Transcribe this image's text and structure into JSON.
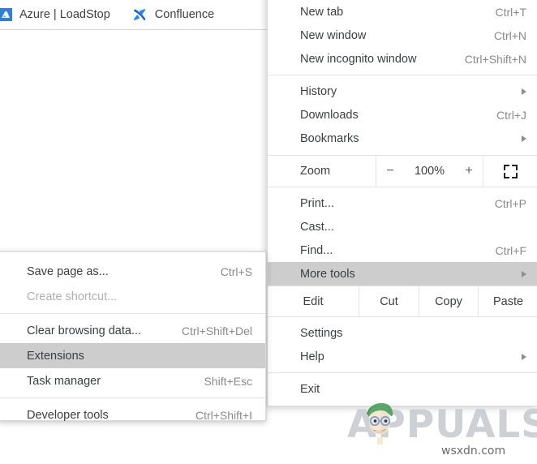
{
  "bookmarks_bar": {
    "items": [
      {
        "label": "Azure | LoadStop",
        "icon": "azure-favicon"
      },
      {
        "label": "Confluence",
        "icon": "confluence-logo-icon"
      }
    ]
  },
  "main_menu": {
    "groups": [
      {
        "items": [
          {
            "label": "New tab",
            "accel": "Ctrl+T",
            "submenu": false,
            "state": "normal"
          },
          {
            "label": "New window",
            "accel": "Ctrl+N",
            "submenu": false,
            "state": "normal"
          },
          {
            "label": "New incognito window",
            "accel": "Ctrl+Shift+N",
            "submenu": false,
            "state": "normal"
          }
        ]
      },
      {
        "items": [
          {
            "label": "History",
            "accel": "",
            "submenu": true,
            "state": "normal"
          },
          {
            "label": "Downloads",
            "accel": "Ctrl+J",
            "submenu": false,
            "state": "normal"
          },
          {
            "label": "Bookmarks",
            "accel": "",
            "submenu": true,
            "state": "normal"
          }
        ]
      },
      {
        "zoom_row": {
          "label": "Zoom",
          "minus": "−",
          "value": "100%",
          "plus": "+",
          "fullscreen_icon": "fullscreen-icon"
        }
      },
      {
        "items": [
          {
            "label": "Print...",
            "accel": "Ctrl+P",
            "submenu": false,
            "state": "normal"
          },
          {
            "label": "Cast...",
            "accel": "",
            "submenu": false,
            "state": "normal"
          },
          {
            "label": "Find...",
            "accel": "Ctrl+F",
            "submenu": false,
            "state": "normal"
          },
          {
            "label": "More tools",
            "accel": "",
            "submenu": true,
            "state": "highlight"
          }
        ]
      },
      {
        "edit_row": {
          "label": "Edit",
          "cut": "Cut",
          "copy": "Copy",
          "paste": "Paste"
        }
      },
      {
        "items": [
          {
            "label": "Settings",
            "accel": "",
            "submenu": false,
            "state": "normal"
          },
          {
            "label": "Help",
            "accel": "",
            "submenu": true,
            "state": "normal"
          }
        ]
      },
      {
        "items": [
          {
            "label": "Exit",
            "accel": "",
            "submenu": false,
            "state": "normal"
          }
        ]
      }
    ]
  },
  "more_tools_submenu": {
    "groups": [
      {
        "items": [
          {
            "label": "Save page as...",
            "accel": "Ctrl+S",
            "state": "normal"
          },
          {
            "label": "Create shortcut...",
            "accel": "",
            "state": "disabled"
          }
        ]
      },
      {
        "items": [
          {
            "label": "Clear browsing data...",
            "accel": "Ctrl+Shift+Del",
            "state": "normal"
          },
          {
            "label": "Extensions",
            "accel": "",
            "state": "highlight"
          },
          {
            "label": "Task manager",
            "accel": "Shift+Esc",
            "state": "normal"
          }
        ]
      },
      {
        "items": [
          {
            "label": "Developer tools",
            "accel": "Ctrl+Shift+I",
            "state": "normal"
          }
        ]
      }
    ]
  },
  "watermark": {
    "brand": "APPUALS",
    "site": "wsxdn.com"
  },
  "colors": {
    "menu_background": "#ffffff",
    "menu_text": "#3c4043",
    "accel_text": "#8a8a8a",
    "highlight": "#cdcdcd",
    "disabled_text": "#b0b0b0",
    "separator": "#e3e3e3",
    "confluence_blue": "#2684ff",
    "azure_blue": "#2f7ed8",
    "watermark_gray": "#c9cdd1"
  }
}
